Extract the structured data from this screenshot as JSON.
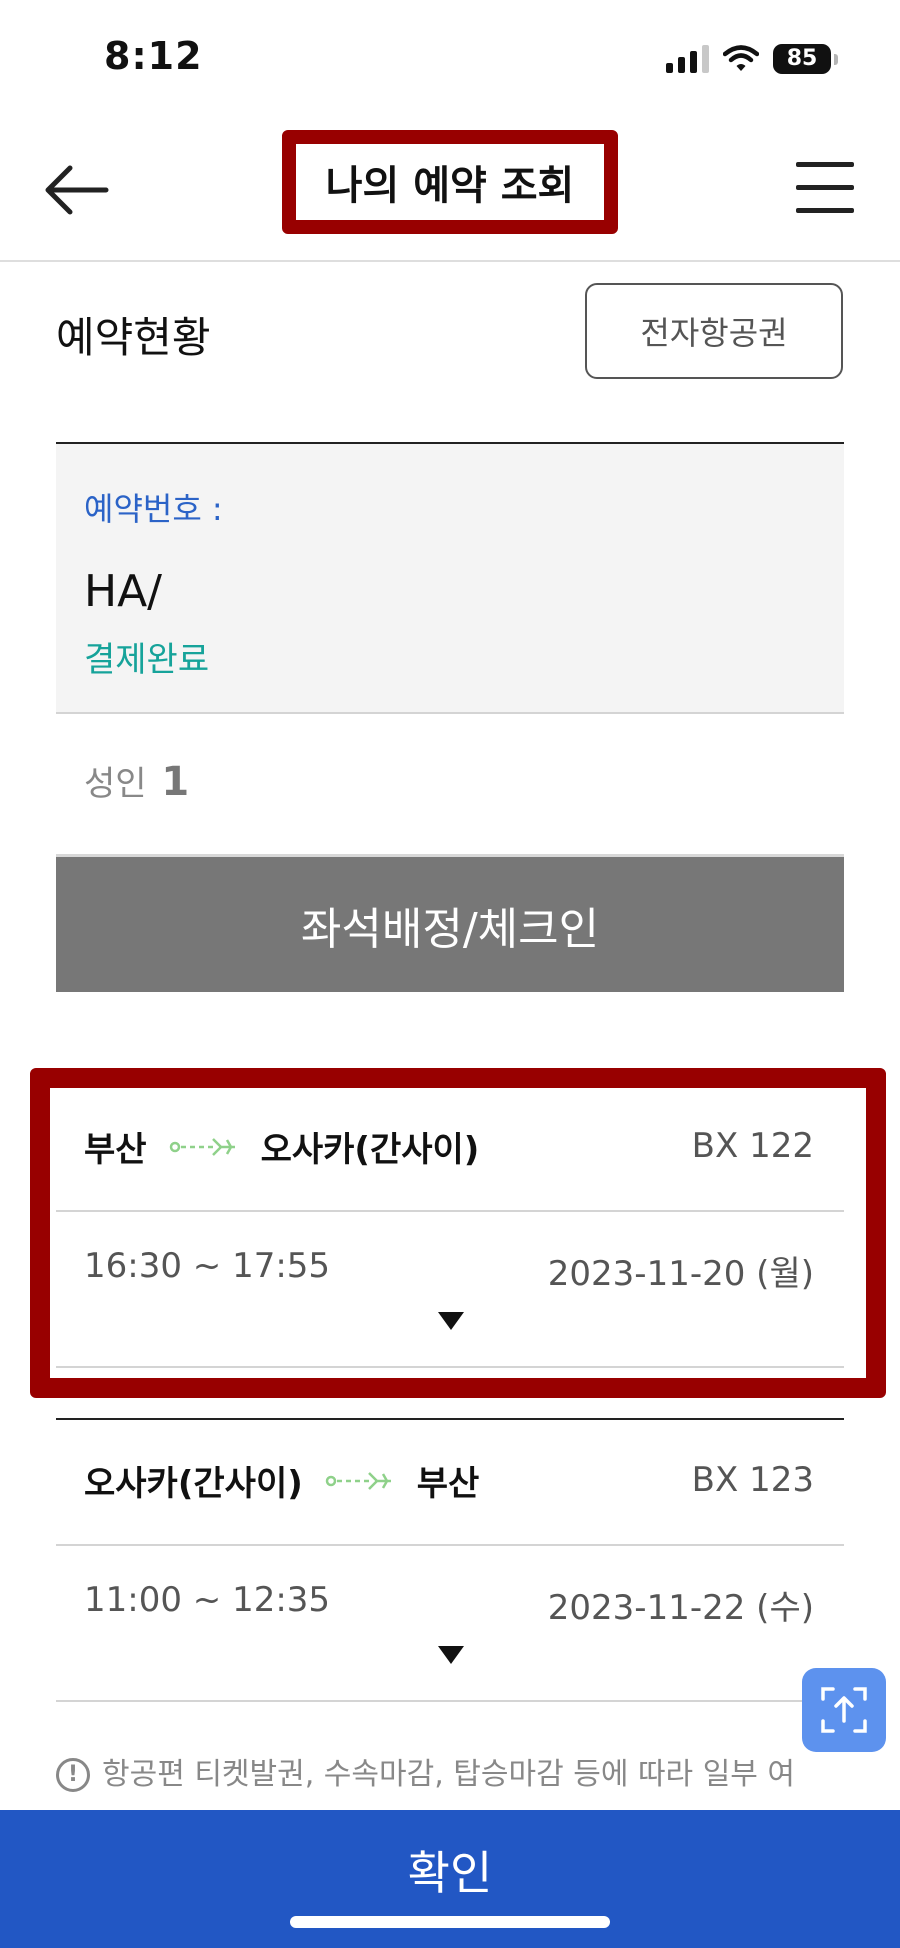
{
  "status_bar": {
    "time": "8:12",
    "battery": "85"
  },
  "header": {
    "title": "나의 예약 조회"
  },
  "section": {
    "title": "예약현황",
    "eticket_label": "전자항공권"
  },
  "reservation": {
    "number_label": "예약번호 :",
    "number_value": "HA/",
    "status": "결제완료"
  },
  "passengers": {
    "label": "성인",
    "count": "1"
  },
  "checkin_label": "좌석배정/체크인",
  "flights": [
    {
      "from": "부산",
      "to": "오사카(간사이)",
      "flight_no": "BX 122",
      "time": "16:30 ~ 17:55",
      "date": "2023-11-20 (월)"
    },
    {
      "from": "오사카(간사이)",
      "to": "부산",
      "flight_no": "BX 123",
      "time": "11:00 ~ 12:35",
      "date": "2023-11-22 (수)"
    }
  ],
  "notice": "항공편 티켓발권, 수속마감, 탑승마감 등에 따라 일부 여",
  "confirm_label": "확인",
  "colors": {
    "accent_blue": "#2257c4",
    "status_green": "#16a39a",
    "highlight_red": "#980000",
    "button_gray": "#777777"
  }
}
